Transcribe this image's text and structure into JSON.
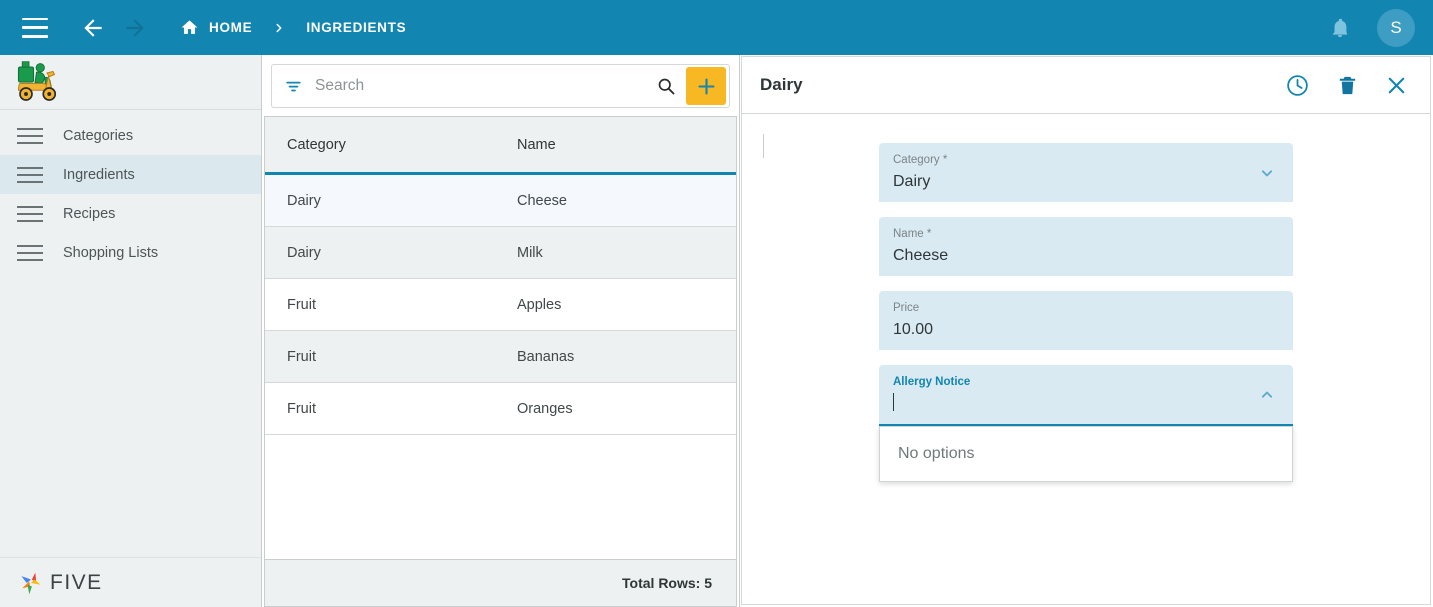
{
  "topbar": {
    "menu_icon": "hamburger-icon",
    "back_icon": "arrow-left-icon",
    "forward_icon": "arrow-right-icon",
    "home_icon": "home-icon",
    "home_label": "HOME",
    "separator_icon": "chevron-right-icon",
    "current_crumb": "INGREDIENTS",
    "notification_icon": "bell-icon",
    "avatar_initial": "S",
    "background_color": "#1285b0"
  },
  "sidebar": {
    "logo_icon": "scooter-delivery-logo",
    "items": [
      {
        "label": "Categories",
        "icon": "list-icon",
        "active": false
      },
      {
        "label": "Ingredients",
        "icon": "list-icon",
        "active": true
      },
      {
        "label": "Recipes",
        "icon": "list-icon",
        "active": false
      },
      {
        "label": "Shopping Lists",
        "icon": "list-icon",
        "active": false
      }
    ],
    "brand_label": "FIVE",
    "brand_icon": "five-pinwheel-logo",
    "active_color": "#dbe8ed"
  },
  "list_pane": {
    "search": {
      "placeholder": "Search",
      "value": "",
      "filter_icon": "filter-icon",
      "search_icon": "search-icon"
    },
    "add_button": {
      "label": "+",
      "icon": "plus-icon",
      "color": "#f7b824"
    },
    "columns": [
      "Category",
      "Name"
    ],
    "rows": [
      {
        "category": "Dairy",
        "name": "Cheese",
        "selected": true
      },
      {
        "category": "Dairy",
        "name": "Milk",
        "selected": false
      },
      {
        "category": "Fruit",
        "name": "Apples",
        "selected": false
      },
      {
        "category": "Fruit",
        "name": "Bananas",
        "selected": false
      },
      {
        "category": "Fruit",
        "name": "Oranges",
        "selected": false
      }
    ],
    "footer_total": "Total Rows: 5"
  },
  "detail": {
    "title": "Dairy",
    "history_icon": "clock-history-icon",
    "delete_icon": "trash-icon",
    "close_icon": "close-icon",
    "fields": [
      {
        "label": "Category *",
        "value": "Dairy",
        "icon": "chevron-down-icon"
      },
      {
        "label": "Name *",
        "value": "Cheese"
      },
      {
        "label": "Price",
        "value": "10.00"
      },
      {
        "label": "Allergy Notice",
        "value": "",
        "icon": "chevron-up-icon",
        "focused": true
      }
    ],
    "dropdown": {
      "empty_label": "No options"
    },
    "field_background": "#daeaf2",
    "accent_color": "#1285b0"
  }
}
